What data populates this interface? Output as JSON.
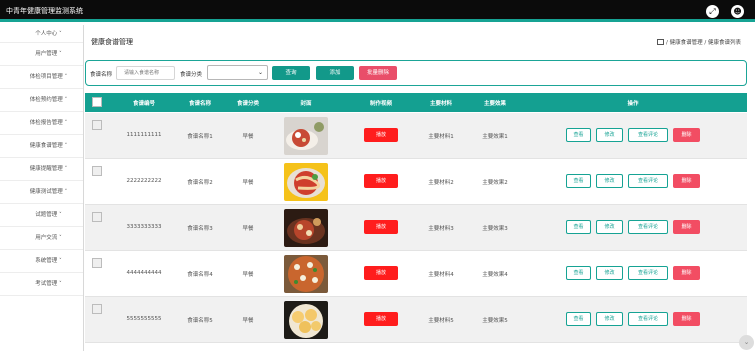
{
  "app": {
    "title": "中青年健康管理监测系统"
  },
  "header_icons": [
    "fullscreen-icon",
    "user-icon"
  ],
  "sidebar": {
    "items": [
      {
        "label": "个人中心 ˅"
      },
      {
        "label": "用户管理 ˅"
      },
      {
        "label": "体检项目管理 ˅"
      },
      {
        "label": "体检预约管理 ˅"
      },
      {
        "label": "体检报告管理 ˅"
      },
      {
        "label": "健康食谱管理 ˅"
      },
      {
        "label": "健康提醒管理 ˅"
      },
      {
        "label": "健康测试管理 ˅"
      },
      {
        "label": "试题管理 ˅"
      },
      {
        "label": "用户交流 ˅"
      },
      {
        "label": "系统管理 ˅"
      },
      {
        "label": "考试管理 ˅"
      }
    ]
  },
  "page": {
    "title": "健康食谱管理",
    "breadcrumb": "/ 健康食谱管理 / 健康食谱列表"
  },
  "search": {
    "name_label": "食谱名称",
    "name_placeholder": "请输入食谱名称",
    "category_label": "食谱分类",
    "query_button": "查询",
    "add_button": "添加",
    "batch_delete_button": "批量删除"
  },
  "table": {
    "headers": [
      "食谱编号",
      "食谱名称",
      "食谱分类",
      "封面",
      "制作视频",
      "主要材料",
      "主要效果",
      "操作"
    ],
    "rows": [
      {
        "code": "1111111111",
        "name": "食谱名称1",
        "category": "早餐",
        "video": "播放",
        "materials": "主要材料1",
        "effect": "主要效果1"
      },
      {
        "code": "2222222222",
        "name": "食谱名称2",
        "category": "早餐",
        "video": "播放",
        "materials": "主要材料2",
        "effect": "主要效果2"
      },
      {
        "code": "3333333333",
        "name": "食谱名称3",
        "category": "早餐",
        "video": "播放",
        "materials": "主要材料3",
        "effect": "主要效果3"
      },
      {
        "code": "4444444444",
        "name": "食谱名称4",
        "category": "早餐",
        "video": "播放",
        "materials": "主要材料4",
        "effect": "主要效果4"
      },
      {
        "code": "5555555555",
        "name": "食谱名称5",
        "category": "早餐",
        "video": "播放",
        "materials": "主要材料5",
        "effect": "主要效果5"
      }
    ],
    "row_actions": {
      "view": "查看",
      "edit": "修改",
      "view_comments": "查看评论",
      "delete": "删除"
    }
  },
  "colors": {
    "accent": "#14a091",
    "danger": "#f24d63",
    "play": "#ff1d1d",
    "topbar": "#0b0b0b"
  }
}
